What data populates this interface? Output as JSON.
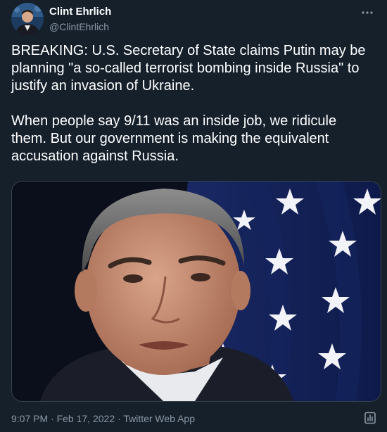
{
  "author": {
    "display_name": "Clint Ehrlich",
    "handle": "@ClintEhrlich",
    "avatar_icon": "profile-photo"
  },
  "tweet": {
    "paragraphs": [
      "BREAKING: U.S. Secretary of State claims Putin may be planning \"a so-called terrorist bombing inside Russia\" to justify an invasion of Ukraine.",
      "When people say 9/11 was an inside job, we ridicule them. But our government is making the equivalent accusation against Russia."
    ]
  },
  "meta": {
    "time": "9:07 PM",
    "separator": "·",
    "date": "Feb 17, 2022",
    "source": "Twitter Web App"
  },
  "icons": {
    "more": "more-icon",
    "analytics": "analytics-icon"
  },
  "colors": {
    "background": "#15202b",
    "text_primary": "#ffffff",
    "text_secondary": "#8b98a5",
    "border": "#38444d"
  }
}
